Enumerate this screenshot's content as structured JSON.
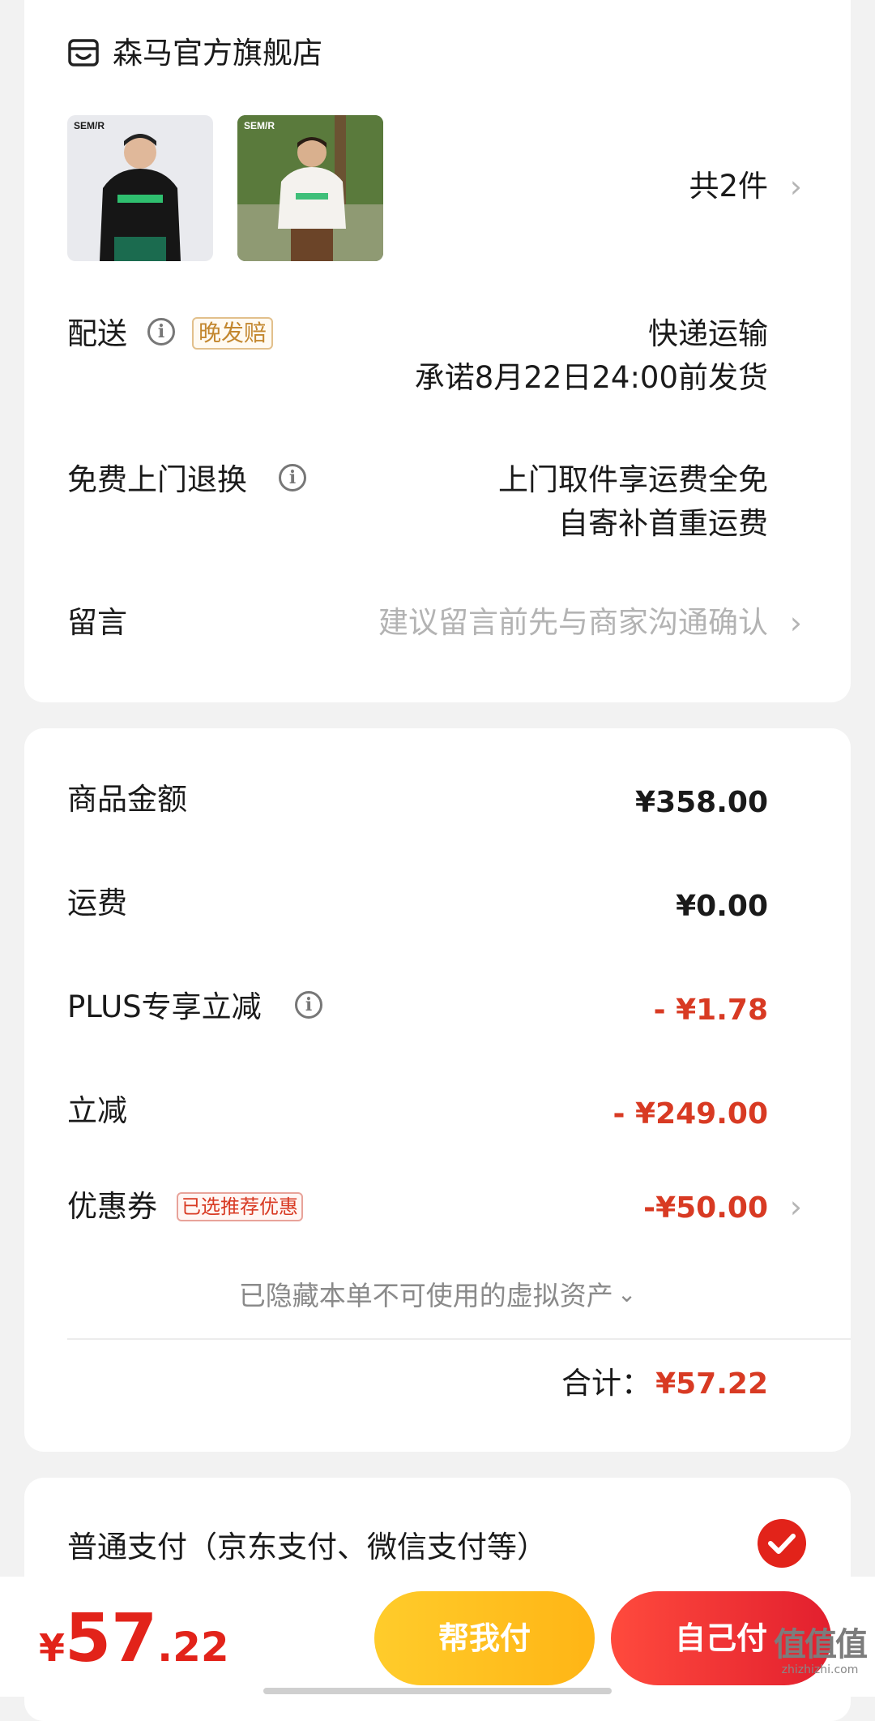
{
  "store": {
    "icon": "store-icon",
    "name": "森马官方旗舰店"
  },
  "items": {
    "count_label": "共2件",
    "thumbnails": [
      {
        "brand": "SEM/R"
      },
      {
        "brand": "SEM/R"
      }
    ]
  },
  "delivery": {
    "label": "配送",
    "badge": "晚发赔",
    "method": "快递运输",
    "promise": "承诺8月22日24:00前发货"
  },
  "return": {
    "label": "免费上门退换",
    "line1": "上门取件享运费全免",
    "line2": "自寄补首重运费"
  },
  "message": {
    "label": "留言",
    "placeholder": "建议留言前先与商家沟通确认"
  },
  "price": {
    "goods_label": "商品金额",
    "goods_value": "¥358.00",
    "shipping_label": "运费",
    "shipping_value": "¥0.00",
    "plus_label": "PLUS专享立减",
    "plus_value": "- ¥1.78",
    "discount_label": "立减",
    "discount_value": "- ¥249.00",
    "coupon_label": "优惠券",
    "coupon_badge": "已选推荐优惠",
    "coupon_value": "-¥50.00",
    "hidden_assets": "已隐藏本单不可使用的虚拟资产",
    "total_label": "合计：",
    "total_value": "¥57.22"
  },
  "payment": {
    "option": "普通支付（京东支付、微信支付等）",
    "selected": true
  },
  "bottom": {
    "currency": "¥",
    "integer": "57",
    "decimal": ".22",
    "help_pay": "帮我付",
    "self_pay": "自己付"
  },
  "watermark": {
    "main": "值值值",
    "sub": "zhizhizhi.com"
  },
  "colors": {
    "red": "#e2231a",
    "orange": "#ffc21e",
    "late_tag": "#c3872f"
  }
}
